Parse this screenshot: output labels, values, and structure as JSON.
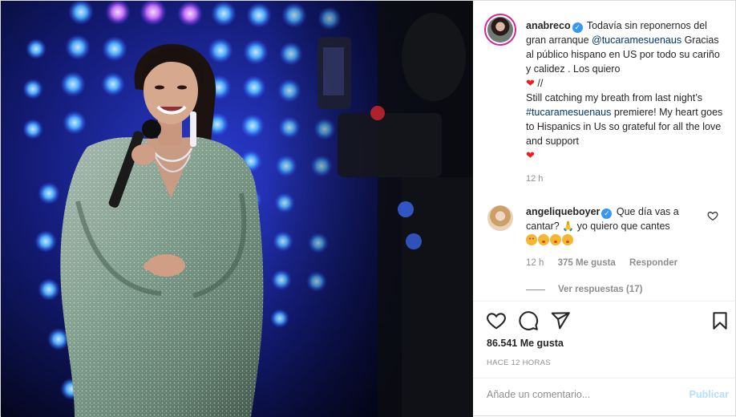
{
  "post": {
    "author": "anabreco",
    "caption": {
      "line1_text": "Todavía sin reponernos del gran arranque",
      "line1_tag": "@tucaramesuenaus",
      "line2": "Gracias al público hispano en US por todo su cariño y calidez . Los quiero",
      "separator": "//",
      "line3_a": "Still catching my breath from last night’s",
      "line3_tag": "#tucaramesuenaus",
      "line3_b": "premiere! My heart goes to Hispanics in Us so grateful for all the love and support"
    },
    "caption_time": "12 h",
    "likes_label": "86.541 Me gusta",
    "date_label": "HACE 12 HORAS"
  },
  "comment": {
    "author": "angeliqueboyer",
    "text": "Que día vas a cantar?",
    "text2": "yo quiero que cantes",
    "time": "12 h",
    "likes": "375 Me gusta",
    "reply": "Responder",
    "view_replies": "Ver respuestas (17)"
  },
  "composer": {
    "placeholder": "Añade un comentario...",
    "publish": "Publicar"
  },
  "icons": {
    "verified": "verified-badge-icon",
    "like": "heart-icon",
    "comment": "comment-icon",
    "share": "paper-plane-icon",
    "save": "bookmark-icon"
  },
  "colors": {
    "link": "#00376b",
    "verified": "#3897f0",
    "muted": "#8e8e8e",
    "publish_disabled": "#b2dffc"
  }
}
